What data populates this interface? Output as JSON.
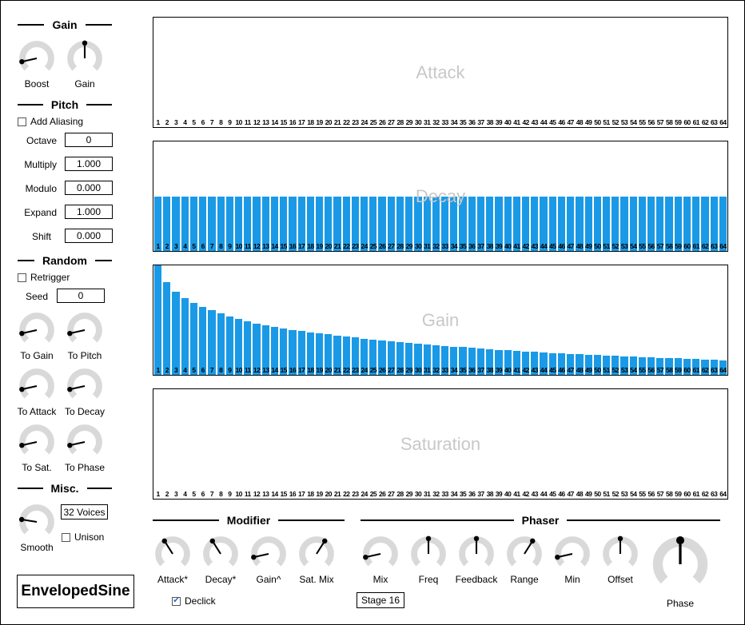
{
  "left": {
    "gain_header": "Gain",
    "boost_label": "Boost",
    "gain_label": "Gain",
    "pitch_header": "Pitch",
    "add_aliasing_label": "Add Aliasing",
    "add_aliasing_checked": false,
    "octave_label": "Octave",
    "octave_value": "0",
    "multiply_label": "Multiply",
    "multiply_value": "1.000",
    "modulo_label": "Modulo",
    "modulo_value": "0.000",
    "expand_label": "Expand",
    "expand_value": "1.000",
    "shift_label": "Shift",
    "shift_value": "0.000",
    "random_header": "Random",
    "retrigger_label": "Retrigger",
    "retrigger_checked": false,
    "seed_label": "Seed",
    "seed_value": "0",
    "to_gain_label": "To Gain",
    "to_pitch_label": "To Pitch",
    "to_attack_label": "To Attack",
    "to_decay_label": "To Decay",
    "to_sat_label": "To Sat.",
    "to_phase_label": "To Phase",
    "misc_header": "Misc.",
    "voices_value": "32 Voices",
    "unison_label": "Unison",
    "unison_checked": false,
    "smooth_label": "Smooth",
    "plugin_name": "EnvelopedSine"
  },
  "panels": {
    "attack_title": "Attack",
    "decay_title": "Decay",
    "gain_title": "Gain",
    "saturation_title": "Saturation",
    "attack_levels": [
      0,
      0,
      0,
      0,
      0,
      0,
      0,
      0,
      0,
      0,
      0,
      0,
      0,
      0,
      0,
      0,
      0,
      0,
      0,
      0,
      0,
      0,
      0,
      0,
      0,
      0,
      0,
      0,
      0,
      0,
      0,
      0,
      0,
      0,
      0,
      0,
      0,
      0,
      0,
      0,
      0,
      0,
      0,
      0,
      0,
      0,
      0,
      0,
      0,
      0,
      0,
      0,
      0,
      0,
      0,
      0,
      0,
      0,
      0,
      0,
      0,
      0,
      0,
      0
    ],
    "decay_levels": [
      0.5,
      0.5,
      0.5,
      0.5,
      0.5,
      0.5,
      0.5,
      0.5,
      0.5,
      0.5,
      0.5,
      0.5,
      0.5,
      0.5,
      0.5,
      0.5,
      0.5,
      0.5,
      0.5,
      0.5,
      0.5,
      0.5,
      0.5,
      0.5,
      0.5,
      0.5,
      0.5,
      0.5,
      0.5,
      0.5,
      0.5,
      0.5,
      0.5,
      0.5,
      0.5,
      0.5,
      0.5,
      0.5,
      0.5,
      0.5,
      0.5,
      0.5,
      0.5,
      0.5,
      0.5,
      0.5,
      0.5,
      0.5,
      0.5,
      0.5,
      0.5,
      0.5,
      0.5,
      0.5,
      0.5,
      0.5,
      0.5,
      0.5,
      0.5,
      0.5,
      0.5,
      0.5,
      0.5,
      0.5
    ],
    "gain_levels": [
      1.0,
      0.85,
      0.76,
      0.7,
      0.66,
      0.62,
      0.59,
      0.56,
      0.53,
      0.51,
      0.49,
      0.47,
      0.455,
      0.44,
      0.425,
      0.41,
      0.4,
      0.39,
      0.38,
      0.37,
      0.36,
      0.35,
      0.34,
      0.33,
      0.322,
      0.314,
      0.306,
      0.298,
      0.291,
      0.284,
      0.277,
      0.27,
      0.264,
      0.258,
      0.252,
      0.246,
      0.24,
      0.235,
      0.23,
      0.225,
      0.22,
      0.215,
      0.21,
      0.205,
      0.2,
      0.196,
      0.192,
      0.188,
      0.184,
      0.18,
      0.176,
      0.172,
      0.168,
      0.165,
      0.162,
      0.159,
      0.156,
      0.153,
      0.15,
      0.147,
      0.144,
      0.141,
      0.138,
      0.135
    ],
    "saturation_levels": [
      0,
      0,
      0,
      0,
      0,
      0,
      0,
      0,
      0,
      0,
      0,
      0,
      0,
      0,
      0,
      0,
      0,
      0,
      0,
      0,
      0,
      0,
      0,
      0,
      0,
      0,
      0,
      0,
      0,
      0,
      0,
      0,
      0,
      0,
      0,
      0,
      0,
      0,
      0,
      0,
      0,
      0,
      0,
      0,
      0,
      0,
      0,
      0,
      0,
      0,
      0,
      0,
      0,
      0,
      0,
      0,
      0,
      0,
      0,
      0,
      0,
      0,
      0,
      0,
      0,
      0
    ]
  },
  "bottom": {
    "modifier_header": "Modifier",
    "phaser_header": "Phaser",
    "attack_knob_label": "Attack*",
    "decay_knob_label": "Decay*",
    "gain_knob_label": "Gain^",
    "sat_mix_label": "Sat. Mix",
    "declick_label": "Declick",
    "declick_checked": true,
    "mix_label": "Mix",
    "freq_label": "Freq",
    "feedback_label": "Feedback",
    "range_label": "Range",
    "min_label": "Min",
    "offset_label": "Offset",
    "phase_label": "Phase",
    "stage_value": "Stage 16"
  },
  "colors": {
    "bar": "#1a9ae6",
    "knob_track": "#d9d9d9",
    "ghost_title": "#c8c8c8"
  },
  "knob_levels": {
    "boost": 0.12,
    "gain": 0.5,
    "to_gain": 0.12,
    "to_pitch": 0.12,
    "to_attack": 0.12,
    "to_decay": 0.12,
    "to_sat": 0.12,
    "to_phase": 0.12,
    "smooth": 0.2,
    "attack": 0.38,
    "decay": 0.38,
    "gain_mod": 0.12,
    "sat_mix": 0.62,
    "mix": 0.12,
    "freq": 0.5,
    "feedback": 0.5,
    "range": 0.62,
    "min": 0.12,
    "offset": 0.5,
    "phase": 0.5
  }
}
